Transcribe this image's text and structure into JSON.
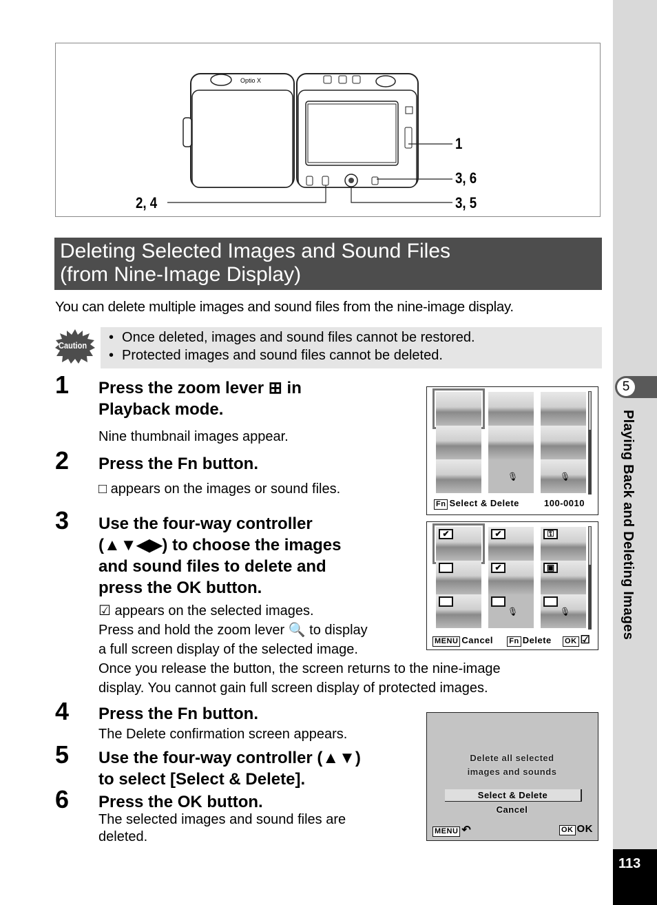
{
  "camera_figure": {
    "brand_label": "Optio X",
    "callouts": [
      "1",
      "3, 6",
      "2, 4",
      "3, 5"
    ]
  },
  "section": {
    "title_line1": "Deleting Selected Images and Sound Files",
    "title_line2": "(from Nine-Image Display)",
    "intro": "You can delete multiple images and sound files from the nine-image display."
  },
  "caution": {
    "icon_label": "Caution",
    "items": [
      "Once deleted, images and sound files cannot be restored.",
      "Protected images and sound files cannot be deleted."
    ]
  },
  "steps": [
    {
      "num": "1",
      "title_line1": "Press the zoom lever ⊞ in",
      "title_line2": "Playback mode.",
      "body": [
        "Nine thumbnail images appear."
      ]
    },
    {
      "num": "2",
      "title": "Press the Fn button.",
      "body": [
        "□ appears on the images or sound files."
      ]
    },
    {
      "num": "3",
      "title_lines": [
        "Use the four-way controller",
        "(▲▼◀▶) to choose the images",
        "and sound files to delete and",
        "press the OK button."
      ],
      "body": [
        "☑ appears on the selected images.",
        "Press and hold the zoom lever 🔍 to display",
        "a full screen display of the selected image.",
        "Once you release the button, the screen returns to the nine-image",
        "display. You cannot gain full screen display of protected images."
      ]
    },
    {
      "num": "4",
      "title": "Press the Fn button.",
      "body": [
        "The Delete confirmation screen appears."
      ]
    },
    {
      "num": "5",
      "title_lines": [
        "Use the four-way controller (▲▼)",
        "to select [Select & Delete]."
      ]
    },
    {
      "num": "6",
      "title": "Press the OK button.",
      "body": [
        "The selected images and sound files are",
        "deleted."
      ]
    }
  ],
  "screen1": {
    "fn_key": "Fn",
    "label": "Select & Delete",
    "file_number": "100-0010"
  },
  "screen2": {
    "menu_key": "MENU",
    "cancel": "Cancel",
    "fn_key": "Fn",
    "delete": "Delete",
    "ok_key": "OK",
    "check_glyph": "☑",
    "checks": [
      "✔",
      "✔",
      "⚿",
      "",
      "✔",
      "▣",
      "",
      "",
      ""
    ]
  },
  "screen3": {
    "message_line1": "Delete all selected",
    "message_line2": "images and sounds",
    "option_selected": "Select & Delete",
    "option_cancel": "Cancel",
    "menu_key": "MENU",
    "back_glyph": "↶",
    "ok_key": "OK",
    "ok_label": "OK"
  },
  "sidebar": {
    "chapter_number": "5",
    "chapter_title": "Playing Back and Deleting Images",
    "page_number": "113"
  }
}
